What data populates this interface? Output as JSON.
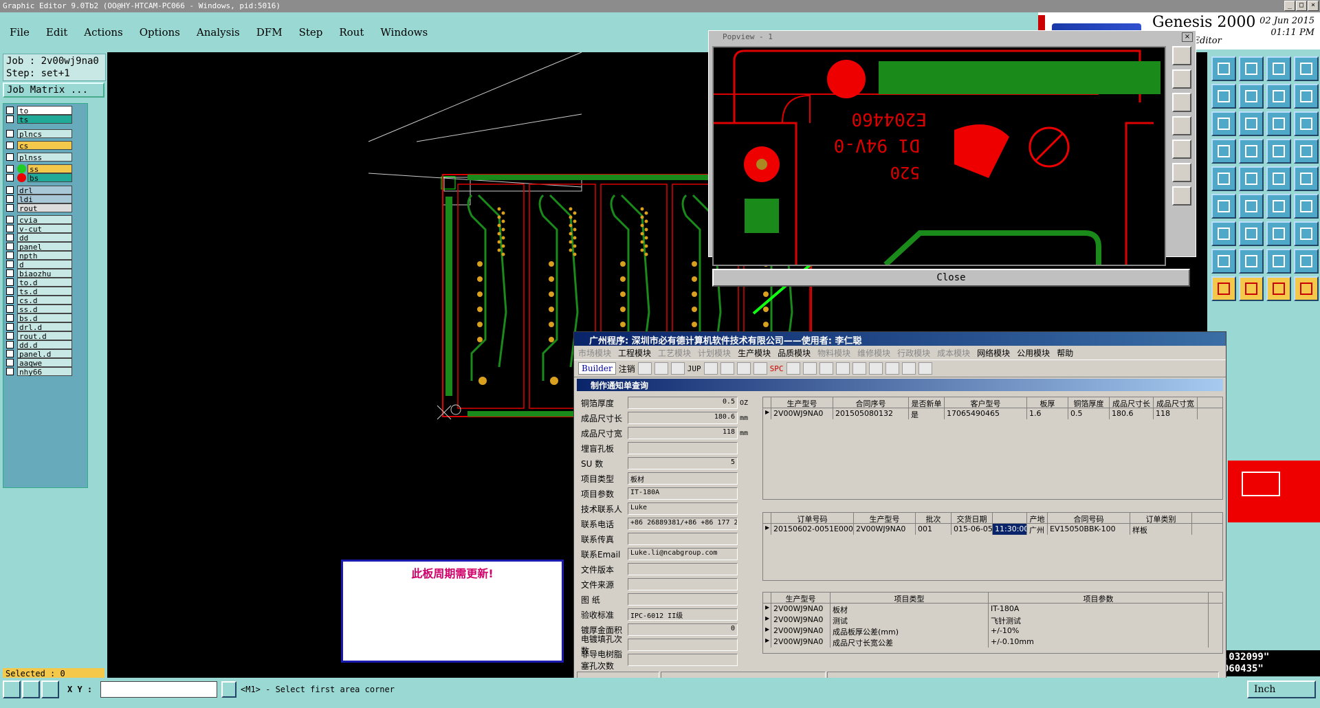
{
  "window": {
    "title": "Graphic Editor 9.0Tb2 (OO@HY-HTCAM-PC066 - Windows, pid:5016)"
  },
  "menu": [
    "File",
    "Edit",
    "Actions",
    "Options",
    "Analysis",
    "DFM",
    "Step",
    "Rout",
    "Windows"
  ],
  "logo": {
    "product": "Genesis 2000",
    "subtitle": "ic Editor",
    "date": "02 Jun 2015",
    "time": "01:11 PM"
  },
  "job": {
    "job": "Job : 2v00wj9na0",
    "step": "Step: set+1",
    "matrix": "Job Matrix ..."
  },
  "layers": [
    "to",
    "ts",
    "plncs",
    "cs",
    "plnss",
    "ss",
    "bs",
    "drl",
    "ldi",
    "rout",
    "cvia",
    "v-cut",
    "dd",
    "panel",
    "npth",
    "d",
    "biaozhu",
    "to.d",
    "ts.d",
    "cs.d",
    "ss.d",
    "bs.d",
    "drl.d",
    "rout.d",
    "dd.d",
    "panel.d",
    "aaqwe",
    "nhy66"
  ],
  "selected": "Selected : 0",
  "bottom": {
    "xy_label": "X Y :",
    "xy_value": "",
    "status": "<M1> - Select first area corner",
    "units": "Inch"
  },
  "coords": {
    "x": "-6.032099\"",
    "y": "6.060435\""
  },
  "notice": "此板周期需更新!",
  "popview": {
    "title": "Popview - 1",
    "close": "Close",
    "text1": "E204460",
    "text2": "D1 94V-0",
    "text3": "520"
  },
  "erp": {
    "title": "广州程序: 深圳市必有德计算机软件技术有限公司——使用者: 李仁聪",
    "menu": [
      "市场模块",
      "工程模块",
      "工艺模块",
      "计划模块",
      "生产模块",
      "品质模块",
      "物料模块",
      "维修模块",
      "行政模块",
      "成本模块",
      "网络模块",
      "公用模块",
      "帮助"
    ],
    "toolbar": [
      "Builder",
      "注销",
      "JUP",
      "SPC"
    ],
    "subtitle": "制作通知单查询",
    "form": [
      {
        "label": "铜箔厚度",
        "value": "0.5",
        "unit": "OZ"
      },
      {
        "label": "成品尺寸长",
        "value": "180.6",
        "unit": "mm"
      },
      {
        "label": "成品尺寸宽",
        "value": "118",
        "unit": "mm"
      },
      {
        "label": "埋盲孔板",
        "value": "",
        "unit": ""
      },
      {
        "label": "SU 数",
        "value": "5",
        "unit": ""
      },
      {
        "label": "项目类型",
        "value": "板材",
        "unit": ""
      },
      {
        "label": "项目参数",
        "value": "IT-180A",
        "unit": ""
      },
      {
        "label": "技术联系人",
        "value": "Luke",
        "unit": ""
      },
      {
        "label": "联系电话",
        "value": "+86 26889381/+86 +86 177 2",
        "unit": ""
      },
      {
        "label": "联系传真",
        "value": "",
        "unit": ""
      },
      {
        "label": "联系Email",
        "value": "Luke.li@ncabgroup.com",
        "unit": ""
      },
      {
        "label": "文件版本",
        "value": "",
        "unit": ""
      },
      {
        "label": "文件来源",
        "value": "",
        "unit": ""
      },
      {
        "label": "图 纸",
        "value": "",
        "unit": ""
      },
      {
        "label": "验收标准",
        "value": "IPC-6012 II级",
        "unit": ""
      },
      {
        "label": "镀厚金面积",
        "value": "0",
        "unit": ""
      },
      {
        "label": "电镀填孔次数",
        "value": "",
        "unit": ""
      },
      {
        "label": "非导电树脂塞孔次数",
        "value": "",
        "unit": ""
      }
    ],
    "grid1": {
      "headers": [
        "生产型号",
        "合同序号",
        "是否新单",
        "客户型号",
        "板厚",
        "铜箔厚度",
        "成品尺寸长",
        "成品尺寸宽"
      ],
      "rows": [
        [
          "2V00WJ9NA0",
          "201505080132",
          "是",
          "17065490465",
          "1.6",
          "0.5",
          "180.6",
          "118"
        ]
      ]
    },
    "grid2": {
      "headers": [
        "订单号码",
        "生产型号",
        "批次",
        "交货日期",
        "",
        "产地",
        "合同号码",
        "订单类别"
      ],
      "rows": [
        [
          "20150602-0051E000",
          "2V00WJ9NA0",
          "001",
          "015-06-05",
          "11:30:00",
          "广州",
          "EV15050BBK-100",
          "样板"
        ]
      ]
    },
    "grid3": {
      "headers": [
        "生产型号",
        "项目类型",
        "项目参数"
      ],
      "rows": [
        [
          "2V00WJ9NA0",
          "板材",
          "IT-180A"
        ],
        [
          "2V00WJ9NA0",
          "测试",
          "飞针测试"
        ],
        [
          "2V00WJ9NA0",
          "成品板厚公差(mm)",
          "+/-10%"
        ],
        [
          "2V00WJ9NA0",
          "成品尺寸长宽公差",
          "+/-0.10mm"
        ]
      ]
    }
  }
}
